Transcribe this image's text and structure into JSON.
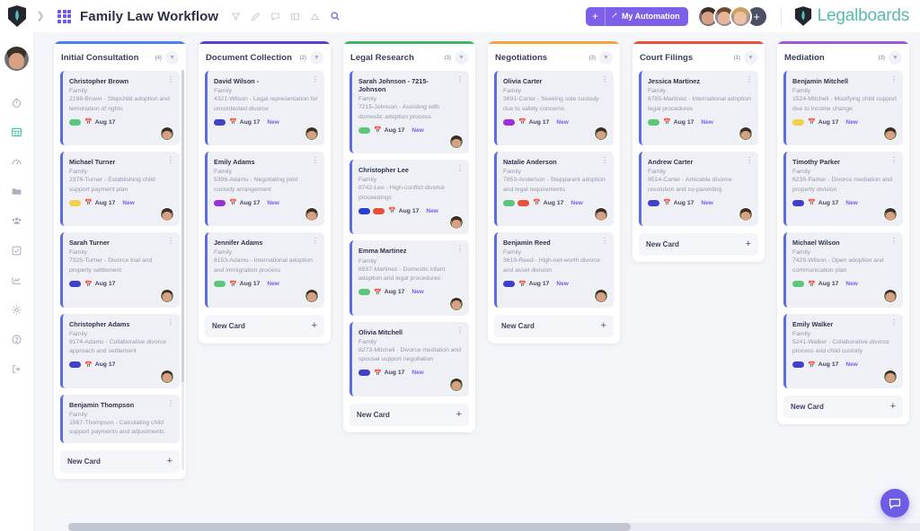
{
  "topbar": {
    "board_title": "Family Law Workflow",
    "collapse_icon": "chevron-right-icon",
    "apps_icon": "apps-grid-icon",
    "tools": [
      {
        "name": "filter-icon",
        "glyph": "▽"
      },
      {
        "name": "edit-pencil-icon",
        "glyph": "✎"
      },
      {
        "name": "comment-icon",
        "glyph": "🗨"
      },
      {
        "name": "table-view-icon",
        "glyph": "▤"
      },
      {
        "name": "share-icon",
        "glyph": "⛛"
      },
      {
        "name": "search-icon",
        "glyph": "🔍"
      }
    ],
    "automation": {
      "plus": "+",
      "label": "My Automation",
      "wand_icon": "magic-wand-icon"
    },
    "avatar_add": "+",
    "brand_name": "Legalboards",
    "brand_color": "#59b9b0",
    "accent_color": "#7d5fe8"
  },
  "sidebar": {
    "avatar_name": "user-avatar",
    "items": [
      {
        "name": "timer-icon",
        "glyph": "⏱",
        "active": false
      },
      {
        "name": "boards-grid-icon",
        "glyph": "▦",
        "active": true
      },
      {
        "name": "dashboard-icon",
        "glyph": "◍",
        "active": false
      },
      {
        "name": "folder-icon",
        "glyph": "▰",
        "active": false
      },
      {
        "name": "team-icon",
        "glyph": "👥",
        "active": false
      },
      {
        "name": "tasks-checkbox-icon",
        "glyph": "☑",
        "active": false
      },
      {
        "name": "reports-chart-icon",
        "glyph": "📈",
        "active": false
      },
      {
        "name": "settings-gear-icon",
        "glyph": "⚙",
        "active": false
      },
      {
        "name": "help-icon",
        "glyph": "?",
        "active": false
      },
      {
        "name": "logout-icon",
        "glyph": "⇥",
        "active": false
      }
    ]
  },
  "board": {
    "new_card_label": "New Card",
    "columns": [
      {
        "title": "Initial Consultation",
        "count": "(4)",
        "color": "#4d7df0",
        "has_scrollbar": true,
        "cards": [
          {
            "title": "Christopher Brown",
            "practice": "Family",
            "description": "2198-Brown - Stepchild adoption and termination of rights",
            "tags": [
              "#5cc77c"
            ],
            "date": "Aug 17",
            "new": "",
            "avatar": true
          },
          {
            "title": "Michael Turner",
            "practice": "Family",
            "description": "2378-Turner - Establishing child support payment plan",
            "tags": [
              "#f2ce4b"
            ],
            "date": "Aug 17",
            "new": "New",
            "avatar": true
          },
          {
            "title": "Sarah Turner",
            "practice": "Family",
            "description": "7325-Turner - Divorce trial and property settlement",
            "tags": [
              "#4040c8"
            ],
            "date": "Aug 17",
            "new": "",
            "avatar": true
          },
          {
            "title": "Christopher Adams",
            "practice": "Family",
            "description": "9174-Adams - Collaborative divorce approach and settlement",
            "tags": [
              "#4040c8"
            ],
            "date": "Aug 17",
            "new": "",
            "avatar": true
          },
          {
            "title": "Benjamin Thompson",
            "practice": "Family",
            "description": "1567-Thompson - Calculating child support payments and adjustments",
            "tags": [],
            "date": "",
            "new": "",
            "avatar": false
          }
        ]
      },
      {
        "title": "Document Collection",
        "count": "(2)",
        "color": "#5a3fd6",
        "has_scrollbar": false,
        "cards": [
          {
            "title": "David Wilson -",
            "practice": "Family",
            "description": "4321-Wilson - Legal representation for uncontested divorce",
            "tags": [
              "#4040c8"
            ],
            "date": "Aug 17",
            "new": "New",
            "avatar": true
          },
          {
            "title": "Emily Adams",
            "practice": "Family",
            "description": "5396-Adams - Negotiating joint custody arrangement",
            "tags": [
              "#9b30d9"
            ],
            "date": "Aug 17",
            "new": "New",
            "avatar": true
          },
          {
            "title": "Jennifer Adams",
            "practice": "Family",
            "description": "6153-Adams - International adoption and immigration process",
            "tags": [
              "#5cc77c"
            ],
            "date": "Aug 17",
            "new": "New",
            "avatar": true
          }
        ]
      },
      {
        "title": "Legal Research",
        "count": "(3)",
        "color": "#3fb56a",
        "has_scrollbar": false,
        "cards": [
          {
            "title": "Sarah Johnson - 7215-Johnson",
            "practice": "Family",
            "description": "7215-Johnson - Assisting with domestic adoption process",
            "tags": [
              "#5cc77c"
            ],
            "date": "Aug 17",
            "new": "New",
            "avatar": true
          },
          {
            "title": "Christopher Lee",
            "practice": "Family",
            "description": "8742-Lee - High-conflict divorce proceedings",
            "tags": [
              "#2a3fd0",
              "#e8503a"
            ],
            "date": "Aug 17",
            "new": "New",
            "avatar": true
          },
          {
            "title": "Emma Martinez",
            "practice": "Family",
            "description": "8937-Martinez - Domestic infant adoption and legal procedures",
            "tags": [
              "#5cc77c"
            ],
            "date": "Aug 17",
            "new": "New",
            "avatar": true
          },
          {
            "title": "Olivia Mitchell",
            "practice": "Family",
            "description": "8273-Mitchell - Divorce mediation and spousal support negotiation",
            "tags": [
              "#4040c8"
            ],
            "date": "Aug 17",
            "new": "New",
            "avatar": true
          }
        ]
      },
      {
        "title": "Negotiations",
        "count": "(3)",
        "color": "#f2a33c",
        "has_scrollbar": false,
        "cards": [
          {
            "title": "Olivia Carter",
            "practice": "Family",
            "description": "3691-Carter - Seeking sole custody due to safety concerns",
            "tags": [
              "#9b30d9"
            ],
            "date": "Aug 17",
            "new": "New",
            "avatar": true
          },
          {
            "title": "Natalie Anderson",
            "practice": "Family",
            "description": "7853-Anderson - Stepparent adoption and legal requirements",
            "tags": [
              "#5cc77c",
              "#e8503a"
            ],
            "date": "Aug 17",
            "new": "New",
            "avatar": true
          },
          {
            "title": "Benjamin Reed",
            "practice": "Family",
            "description": "3619-Reed - High-net-worth divorce and asset division",
            "tags": [
              "#4040c8"
            ],
            "date": "Aug 17",
            "new": "New",
            "avatar": true
          }
        ]
      },
      {
        "title": "Court Filings",
        "count": "(1)",
        "color": "#e8503a",
        "has_scrollbar": false,
        "cards": [
          {
            "title": "Jessica Martinez",
            "practice": "Family",
            "description": "6785-Martinez - International adoption legal procedures",
            "tags": [
              "#5cc77c"
            ],
            "date": "Aug 17",
            "new": "New",
            "avatar": true
          },
          {
            "title": "Andrew Carter",
            "practice": "Family",
            "description": "9514-Carter - Amicable divorce resolution and co-parenting",
            "tags": [
              "#4040c8"
            ],
            "date": "Aug 17",
            "new": "New",
            "avatar": true
          }
        ]
      },
      {
        "title": "Mediation",
        "count": "(3)",
        "color": "#9b59d9",
        "has_scrollbar": false,
        "cards": [
          {
            "title": "Benjamin Mitchell",
            "practice": "Family",
            "description": "1524-Mitchell - Modifying child support due to income change",
            "tags": [
              "#f2ce4b"
            ],
            "date": "Aug 17",
            "new": "New",
            "avatar": true
          },
          {
            "title": "Timothy Parker",
            "practice": "Family",
            "description": "6235-Parker - Divorce mediation and property division",
            "tags": [
              "#4040c8"
            ],
            "date": "Aug 17",
            "new": "New",
            "avatar": true
          },
          {
            "title": "Michael Wilson",
            "practice": "Family",
            "description": "7429-Wilson - Open adoption and communication plan",
            "tags": [
              "#5cc77c"
            ],
            "date": "Aug 17",
            "new": "New",
            "avatar": true
          },
          {
            "title": "Emily Walker",
            "practice": "Family",
            "description": "5241-Walker - Collaborative divorce process and child custody",
            "tags": [
              "#4040c8"
            ],
            "date": "Aug 17",
            "new": "New",
            "avatar": true
          }
        ]
      }
    ]
  },
  "chat": {
    "icon": "chat-bubble-icon",
    "color": "#6c5ce7"
  }
}
